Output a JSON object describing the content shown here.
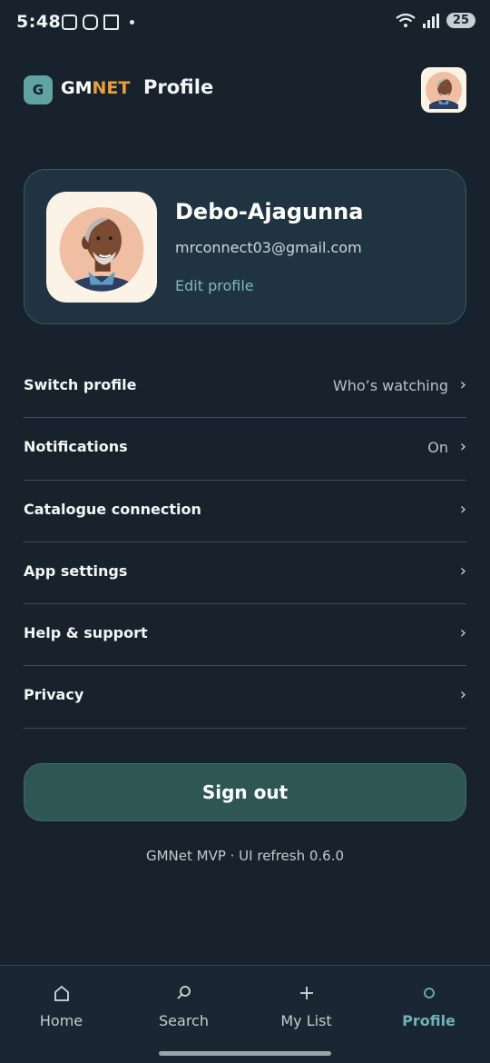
{
  "status_bar": {
    "time": "5:48",
    "battery": "25",
    "icons": [
      "screenshot-icon",
      "instagram-icon",
      "calendar-icon",
      "wifi-icon",
      "signal-icon"
    ]
  },
  "header": {
    "logo_badge": "G",
    "logo_gm": "GM",
    "logo_net": "NET",
    "title": "Profile",
    "brand_color": "#e8a13a"
  },
  "profile": {
    "name": "Debo-Ajagunna",
    "email": "mrconnect03@gmail.com",
    "edit_label": "Edit profile"
  },
  "menu": {
    "items": [
      {
        "label": "Switch profile",
        "value": "Who’s watching"
      },
      {
        "label": "Notifications",
        "value": "On"
      },
      {
        "label": "Catalogue connection",
        "value": ""
      },
      {
        "label": "App settings",
        "value": ""
      },
      {
        "label": "Help & support",
        "value": ""
      },
      {
        "label": "Privacy",
        "value": ""
      }
    ],
    "chevron": "›"
  },
  "signout_label": "Sign out",
  "version": "GMNet MVP · UI refresh 0.6.0",
  "nav": {
    "items": [
      {
        "label": "Home",
        "icon": "home-icon"
      },
      {
        "label": "Search",
        "icon": "search-icon"
      },
      {
        "label": "My List",
        "icon": "plus-icon"
      },
      {
        "label": "Profile",
        "icon": "profile-icon"
      }
    ],
    "active": "Profile",
    "accent_color": "#6fb3b8"
  }
}
